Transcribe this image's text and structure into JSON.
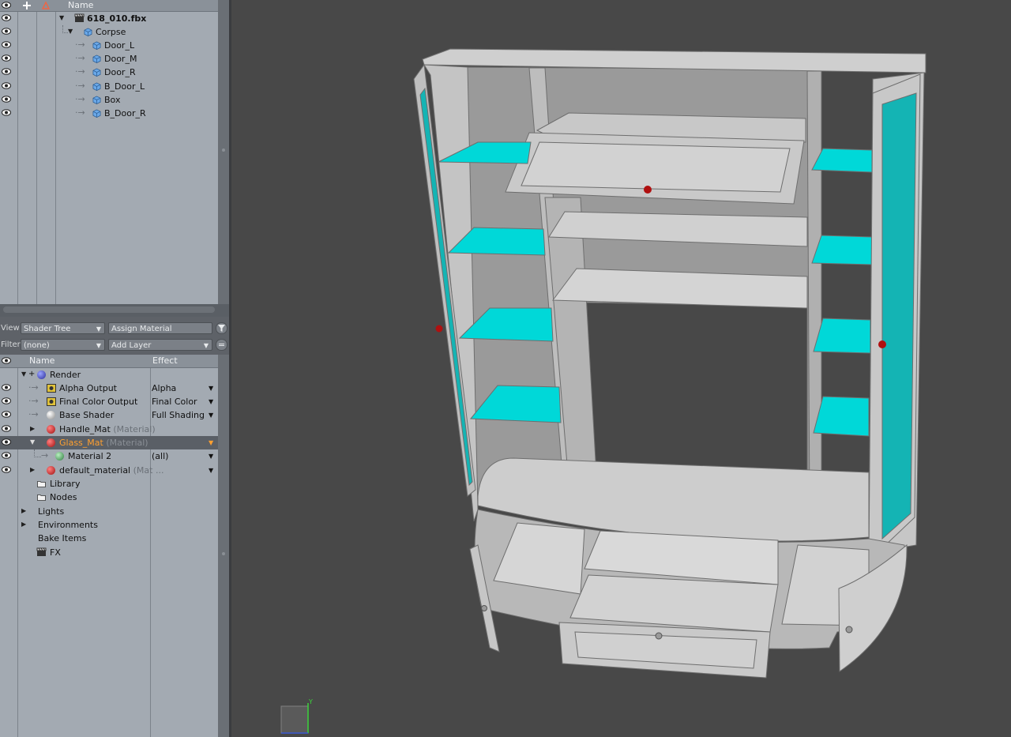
{
  "item_list": {
    "header": {
      "name": "Name"
    },
    "items": [
      {
        "label": "618_010.fbx",
        "depth": 0
      },
      {
        "label": "Corpse",
        "depth": 1
      },
      {
        "label": "Door_L",
        "depth": 2
      },
      {
        "label": "Door_M",
        "depth": 2
      },
      {
        "label": "Door_R",
        "depth": 2
      },
      {
        "label": "B_Door_L",
        "depth": 2
      },
      {
        "label": "Box",
        "depth": 2
      },
      {
        "label": "B_Door_R",
        "depth": 2
      }
    ]
  },
  "shader_toolbar": {
    "view_label": "View",
    "view_value": "Shader Tree",
    "assign_material": "Assign Material",
    "filter_label": "Filter",
    "filter_value": "(none)",
    "add_layer": "Add Layer"
  },
  "shader_tree": {
    "header": {
      "name": "Name",
      "effect": "Effect"
    },
    "rows": [
      {
        "label": "Render",
        "effect": ""
      },
      {
        "label": "Alpha Output",
        "effect": "Alpha"
      },
      {
        "label": "Final Color Output",
        "effect": "Final Color"
      },
      {
        "label": "Base Shader",
        "effect": "Full Shading"
      },
      {
        "label": "Handle_Mat",
        "suffix": "(Material)",
        "effect": ""
      },
      {
        "label": "Glass_Mat",
        "suffix": "(Material)",
        "effect": ""
      },
      {
        "label": "Material 2",
        "effect": "(all)"
      },
      {
        "label": "default_material",
        "suffix": "(Mat ...",
        "effect": ""
      },
      {
        "label": "Library"
      },
      {
        "label": "Nodes"
      },
      {
        "label": "Lights"
      },
      {
        "label": "Environments"
      },
      {
        "label": "Bake Items"
      },
      {
        "label": "FX"
      }
    ]
  },
  "viewport": {
    "axis_y_label": "Y",
    "colors": {
      "background": "#484848",
      "body": "#c8c8c8",
      "glass": "#00d8d8",
      "glass_door": "#14b4b4",
      "handle": "#b01010"
    }
  },
  "colors": {
    "panel": "#a3aab2",
    "selection": "#5a5f66",
    "accent_text": "#ffa030"
  }
}
